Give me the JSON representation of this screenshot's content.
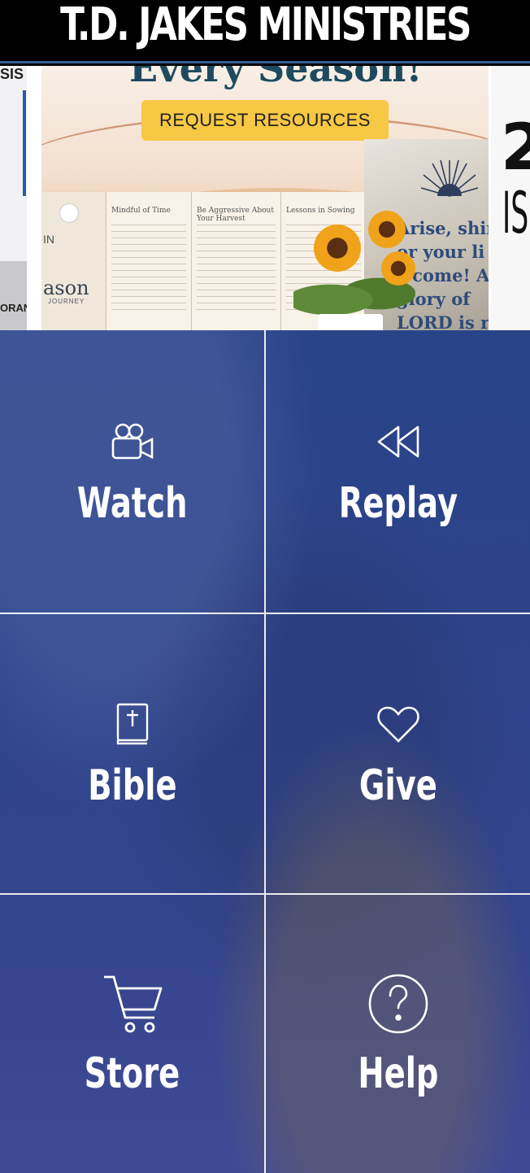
{
  "header": {
    "logo_text": "T.D. JAKES MINISTRIES"
  },
  "carousel": {
    "prev_slide_text_top": "SIS",
    "prev_slide_text_bottom": "ORANG",
    "main_slide": {
      "headline": "Every Season!",
      "button_label": "REQUEST RESOURCES",
      "booklet_brand": "ason",
      "booklet_brand_sub": "JOURNEY",
      "booklet_in": "IN",
      "page_titles": [
        "Mindful of Time",
        "Be Aggressive About Your Harvest",
        "Lessons in Sowing"
      ],
      "verse_lines": [
        "Arise, shir",
        "or your li",
        "s come! A",
        "glory of",
        "LORD is ris"
      ]
    },
    "next_slide_text_top": "2",
    "next_slide_text_bottom": "IS"
  },
  "tiles": [
    {
      "label": "Watch",
      "icon": "video-camera-icon"
    },
    {
      "label": "Replay",
      "icon": "rewind-icon"
    },
    {
      "label": "Bible",
      "icon": "bible-icon"
    },
    {
      "label": "Give",
      "icon": "heart-icon"
    },
    {
      "label": "Store",
      "icon": "shopping-cart-icon"
    },
    {
      "label": "Help",
      "icon": "help-question-icon"
    }
  ],
  "colors": {
    "header_bg": "#000000",
    "grid_overlay": "#2c438a",
    "button_yellow": "#f6c844"
  }
}
